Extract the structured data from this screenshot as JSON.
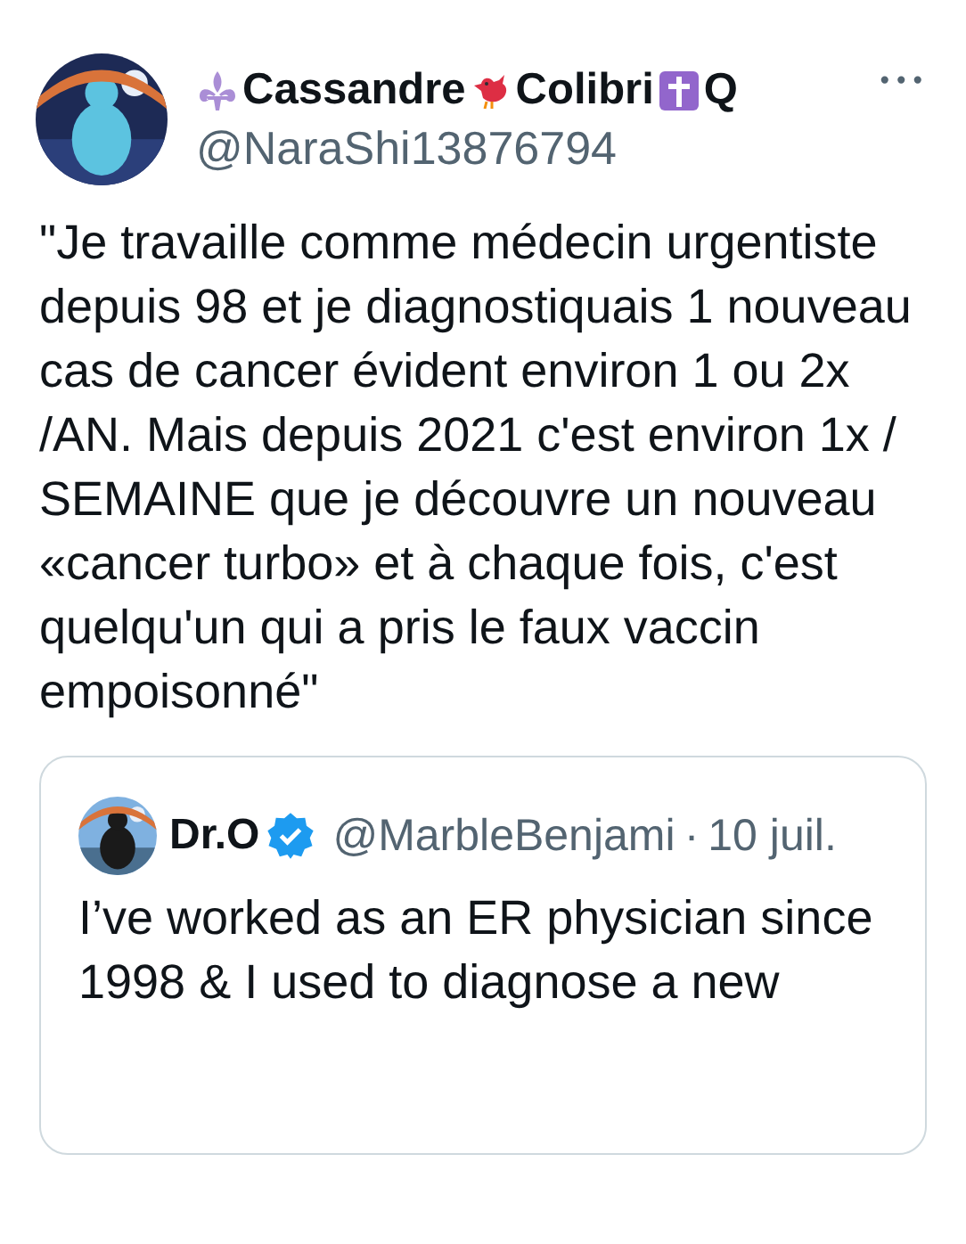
{
  "tweet": {
    "author": {
      "name_parts": [
        {
          "kind": "emoji-fleur"
        },
        {
          "kind": "text",
          "text": "Cassandre"
        },
        {
          "kind": "emoji-bird"
        },
        {
          "kind": "text",
          "text": "Colibri"
        },
        {
          "kind": "emoji-cross"
        },
        {
          "kind": "text",
          "text": "Q"
        }
      ],
      "handle": "@NaraShi13876794"
    },
    "more": "•••",
    "text": "\"Je travaille comme médecin urgentiste depuis 98 et je diagnostiquais 1 nouveau cas de cancer évident environ 1 ou 2x /AN. Mais depuis 2021 c'est environ 1x / SEMAINE que je découvre un nouveau «cancer turbo» et à chaque fois, c'est quelqu'un qui a pris le faux vaccin empoisonné\"",
    "quote": {
      "name": "Dr.O",
      "verified": true,
      "handle": "@MarbleBenjami",
      "separator": "·",
      "date": "10 juil.",
      "text": "I’ve worked as an ER physician since 1998 & I used to diagnose a new"
    }
  }
}
